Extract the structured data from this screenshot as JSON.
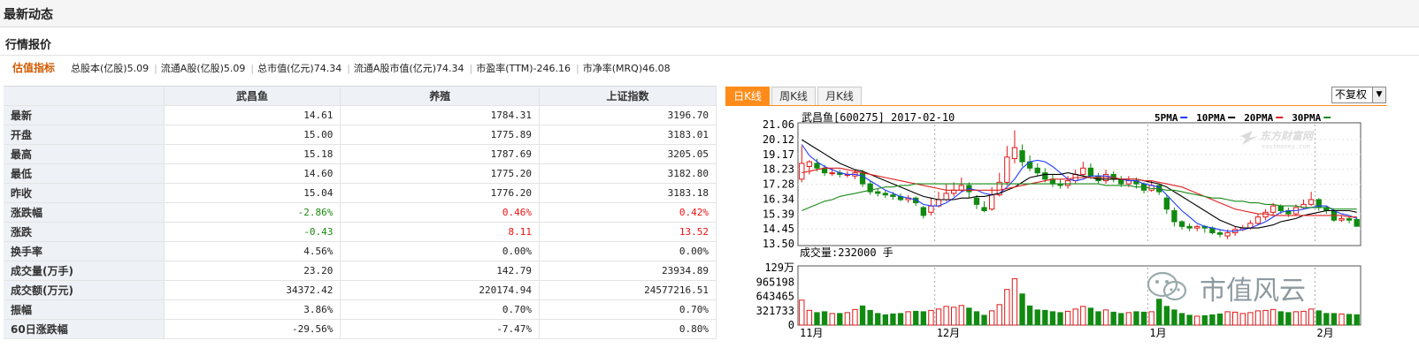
{
  "header": {
    "title": "最新动态"
  },
  "section": {
    "title": "行情报价"
  },
  "valuation": {
    "label": "估值指标",
    "items": [
      "总股本(亿股)5.09",
      "流通A股(亿股)5.09",
      "总市值(亿元)74.34",
      "流通A股市值(亿元)74.34",
      "市盈率(TTM)-246.16",
      "市净率(MRQ)46.08"
    ]
  },
  "quote_table": {
    "columns": [
      "",
      "武昌鱼",
      "养殖",
      "上证指数"
    ],
    "rows": [
      {
        "label": "最新",
        "v": [
          "14.61",
          "1784.31",
          "3196.70"
        ],
        "c": [
          "k",
          "k",
          "k"
        ]
      },
      {
        "label": "开盘",
        "v": [
          "15.00",
          "1775.89",
          "3183.01"
        ],
        "c": [
          "k",
          "k",
          "k"
        ]
      },
      {
        "label": "最高",
        "v": [
          "15.18",
          "1787.69",
          "3205.05"
        ],
        "c": [
          "k",
          "k",
          "k"
        ]
      },
      {
        "label": "最低",
        "v": [
          "14.60",
          "1775.20",
          "3182.80"
        ],
        "c": [
          "k",
          "k",
          "k"
        ]
      },
      {
        "label": "昨收",
        "v": [
          "15.04",
          "1776.20",
          "3183.18"
        ],
        "c": [
          "k",
          "k",
          "k"
        ]
      },
      {
        "label": "涨跌幅",
        "v": [
          "-2.86%",
          "0.46%",
          "0.42%"
        ],
        "c": [
          "g",
          "r",
          "r"
        ]
      },
      {
        "label": "涨跌",
        "v": [
          "-0.43",
          "8.11",
          "13.52"
        ],
        "c": [
          "g",
          "r",
          "r"
        ]
      },
      {
        "label": "换手率",
        "v": [
          "4.56%",
          "0.00%",
          "0.00%"
        ],
        "c": [
          "k",
          "k",
          "k"
        ]
      },
      {
        "label": "成交量(万手)",
        "v": [
          "23.20",
          "142.79",
          "23934.89"
        ],
        "c": [
          "k",
          "k",
          "k"
        ]
      },
      {
        "label": "成交额(万元)",
        "v": [
          "34372.42",
          "220174.94",
          "24577216.51"
        ],
        "c": [
          "k",
          "k",
          "k"
        ]
      },
      {
        "label": "振幅",
        "v": [
          "3.86%",
          "0.70%",
          "0.70%"
        ],
        "c": [
          "k",
          "k",
          "k"
        ]
      },
      {
        "label": "60日涨跌幅",
        "v": [
          "-29.56%",
          "-7.47%",
          "0.80%"
        ],
        "c": [
          "k",
          "k",
          "k"
        ]
      }
    ]
  },
  "chart_tabs": [
    "日K线",
    "周K线",
    "月K线"
  ],
  "fuquan": {
    "selected": "不复权",
    "arrow": "▼"
  },
  "kline": {
    "title": "武昌鱼[600275] 2017-02-10",
    "legend": [
      {
        "name": "5PMA",
        "color": "#1f3cff"
      },
      {
        "name": "10PMA",
        "color": "#000000"
      },
      {
        "name": "20PMA",
        "color": "#e02020"
      },
      {
        "name": "30PMA",
        "color": "#1a8a1a"
      }
    ],
    "watermark": "东方财富网",
    "watermark_sub": "eastmoney.com",
    "volume_label": "成交量:232000 手",
    "vol_unit": "129万",
    "x_labels": [
      "11月",
      "12月",
      "1月",
      "2月"
    ]
  },
  "chart_data": {
    "type": "candlestick",
    "ylim": [
      13.5,
      21.06
    ],
    "price_ticks": [
      "21.06",
      "20.12",
      "19.17",
      "18.23",
      "17.28",
      "16.34",
      "15.39",
      "14.45",
      "13.50"
    ],
    "vol_ticks": [
      "129万",
      "965198",
      "643465",
      "321733",
      "0"
    ],
    "vol_max": 1290000,
    "month_marks": [
      {
        "label": "11月",
        "i": 0
      },
      {
        "label": "12月",
        "i": 18
      },
      {
        "label": "1月",
        "i": 46
      },
      {
        "label": "2月",
        "i": 68
      }
    ],
    "candles": [
      [
        17.6,
        18.6,
        19.7,
        17.4,
        560000
      ],
      [
        18.4,
        18.7,
        18.8,
        17.9,
        330000
      ],
      [
        18.6,
        18.3,
        18.9,
        18.1,
        280000
      ],
      [
        18.3,
        18.0,
        18.5,
        17.8,
        300000
      ],
      [
        18.0,
        18.0,
        18.3,
        17.8,
        260000
      ],
      [
        18.0,
        17.9,
        18.2,
        17.7,
        260000
      ],
      [
        17.9,
        17.9,
        18.1,
        17.7,
        280000
      ],
      [
        17.8,
        18.0,
        18.2,
        17.6,
        350000
      ],
      [
        18.0,
        17.3,
        18.2,
        17.1,
        430000
      ],
      [
        17.3,
        16.8,
        17.5,
        16.6,
        330000
      ],
      [
        16.8,
        16.7,
        17.0,
        16.5,
        260000
      ],
      [
        16.7,
        16.6,
        16.9,
        16.4,
        230000
      ],
      [
        16.6,
        16.5,
        16.8,
        16.3,
        250000
      ],
      [
        16.5,
        16.3,
        16.7,
        16.2,
        260000
      ],
      [
        16.3,
        16.4,
        16.6,
        16.1,
        300000
      ],
      [
        16.4,
        16.1,
        16.5,
        15.9,
        310000
      ],
      [
        15.8,
        15.3,
        15.9,
        15.1,
        300000
      ],
      [
        15.5,
        15.9,
        16.4,
        15.3,
        330000
      ],
      [
        15.9,
        16.3,
        16.8,
        15.8,
        360000
      ],
      [
        16.3,
        16.7,
        17.3,
        16.2,
        420000
      ],
      [
        16.7,
        16.9,
        17.4,
        16.5,
        400000
      ],
      [
        16.9,
        17.2,
        17.7,
        16.8,
        440000
      ],
      [
        17.2,
        16.8,
        17.4,
        16.4,
        380000
      ],
      [
        16.4,
        16.0,
        16.6,
        15.7,
        300000
      ],
      [
        15.8,
        15.6,
        16.2,
        15.5,
        220000
      ],
      [
        15.7,
        16.6,
        17.1,
        15.6,
        320000
      ],
      [
        16.6,
        17.4,
        18.0,
        16.5,
        460000
      ],
      [
        17.4,
        19.0,
        19.7,
        17.2,
        800000
      ],
      [
        18.9,
        19.6,
        20.7,
        18.6,
        1040000
      ],
      [
        19.4,
        18.7,
        19.8,
        18.4,
        700000
      ],
      [
        18.7,
        18.3,
        19.1,
        18.1,
        430000
      ],
      [
        18.3,
        18.0,
        18.6,
        17.8,
        340000
      ],
      [
        18.0,
        17.6,
        18.3,
        17.4,
        330000
      ],
      [
        17.6,
        17.3,
        17.9,
        17.1,
        300000
      ],
      [
        17.3,
        17.2,
        17.6,
        17.0,
        280000
      ],
      [
        17.2,
        17.5,
        17.8,
        17.0,
        310000
      ],
      [
        17.5,
        17.9,
        18.2,
        17.3,
        360000
      ],
      [
        17.9,
        18.3,
        18.7,
        17.7,
        420000
      ],
      [
        18.3,
        17.8,
        18.6,
        17.6,
        380000
      ],
      [
        17.8,
        17.5,
        18.0,
        17.3,
        300000
      ],
      [
        17.5,
        17.9,
        18.2,
        17.3,
        340000
      ],
      [
        17.9,
        17.6,
        18.1,
        17.4,
        290000
      ],
      [
        17.6,
        17.3,
        17.8,
        17.1,
        260000
      ],
      [
        17.3,
        17.5,
        17.8,
        17.1,
        280000
      ],
      [
        17.5,
        17.3,
        17.7,
        17.0,
        300000
      ],
      [
        17.3,
        16.9,
        17.4,
        16.7,
        290000
      ],
      [
        16.9,
        17.2,
        17.5,
        16.8,
        300000
      ],
      [
        17.2,
        16.8,
        17.3,
        16.6,
        580000
      ],
      [
        16.4,
        15.7,
        16.6,
        15.4,
        420000
      ],
      [
        15.6,
        14.9,
        15.8,
        14.6,
        340000
      ],
      [
        14.9,
        14.6,
        15.0,
        14.4,
        260000
      ],
      [
        14.6,
        14.5,
        14.8,
        14.3,
        220000
      ],
      [
        14.5,
        14.6,
        14.7,
        14.3,
        200000
      ],
      [
        14.6,
        14.5,
        14.7,
        14.2,
        210000
      ],
      [
        14.5,
        14.2,
        14.6,
        14.1,
        230000
      ],
      [
        14.2,
        14.1,
        14.4,
        13.9,
        250000
      ],
      [
        14.0,
        14.2,
        14.4,
        13.8,
        300000
      ],
      [
        14.2,
        14.4,
        14.6,
        14.0,
        290000
      ],
      [
        14.4,
        14.5,
        14.7,
        14.3,
        260000
      ],
      [
        14.5,
        14.8,
        15.0,
        14.4,
        280000
      ],
      [
        14.8,
        15.2,
        15.4,
        14.7,
        320000
      ],
      [
        15.2,
        15.5,
        15.7,
        15.0,
        330000
      ],
      [
        15.5,
        15.9,
        16.1,
        15.3,
        350000
      ],
      [
        15.9,
        15.6,
        16.0,
        15.4,
        300000
      ],
      [
        15.6,
        15.4,
        15.8,
        15.2,
        280000
      ],
      [
        15.4,
        15.8,
        16.0,
        15.3,
        300000
      ],
      [
        15.8,
        16.0,
        16.3,
        15.7,
        310000
      ],
      [
        16.0,
        16.3,
        16.8,
        15.9,
        360000
      ],
      [
        16.3,
        15.8,
        16.4,
        15.6,
        320000
      ],
      [
        15.8,
        15.6,
        15.9,
        15.4,
        260000
      ],
      [
        15.6,
        15.0,
        15.7,
        14.9,
        260000
      ],
      [
        15.0,
        15.1,
        15.3,
        14.9,
        250000
      ],
      [
        15.1,
        15.0,
        15.2,
        14.8,
        240000
      ],
      [
        15.04,
        14.61,
        15.18,
        14.6,
        232000
      ]
    ],
    "ma": {
      "5PMA": [
        19.8,
        19.1,
        18.7,
        18.4,
        18.2,
        18.0,
        17.9,
        17.9,
        17.8,
        17.5,
        17.2,
        16.9,
        16.7,
        16.5,
        16.4,
        16.3,
        16.0,
        15.9,
        15.9,
        16.1,
        16.4,
        16.8,
        17.0,
        16.9,
        16.7,
        16.6,
        16.7,
        17.1,
        17.6,
        18.3,
        18.7,
        18.8,
        18.7,
        18.4,
        18.0,
        17.6,
        17.5,
        17.6,
        17.8,
        17.8,
        17.8,
        17.7,
        17.6,
        17.5,
        17.5,
        17.3,
        17.2,
        17.1,
        16.6,
        16.1,
        15.6,
        15.2,
        14.8,
        14.6,
        14.5,
        14.4,
        14.3,
        14.3,
        14.4,
        14.5,
        14.7,
        14.9,
        15.2,
        15.5,
        15.6,
        15.6,
        15.7,
        15.8,
        15.9,
        15.9,
        15.6,
        15.4,
        15.3,
        15.1
      ],
      "10PMA": [
        20.1,
        19.8,
        19.5,
        19.2,
        18.9,
        18.6,
        18.4,
        18.2,
        18.1,
        17.9,
        17.7,
        17.5,
        17.3,
        17.1,
        16.9,
        16.7,
        16.5,
        16.4,
        16.3,
        16.3,
        16.3,
        16.4,
        16.4,
        16.5,
        16.5,
        16.6,
        16.7,
        16.9,
        17.1,
        17.4,
        17.7,
        17.8,
        17.9,
        17.9,
        17.9,
        18.0,
        17.9,
        17.8,
        17.7,
        17.6,
        17.6,
        17.6,
        17.6,
        17.6,
        17.6,
        17.5,
        17.4,
        17.3,
        17.1,
        16.8,
        16.5,
        16.2,
        15.9,
        15.6,
        15.3,
        15.0,
        14.8,
        14.6,
        14.5,
        14.5,
        14.5,
        14.6,
        14.7,
        14.9,
        15.0,
        15.1,
        15.3,
        15.4,
        15.5,
        15.6,
        15.6,
        15.6,
        15.6,
        15.5
      ],
      "20PMA": [
        18.0,
        18.1,
        18.2,
        18.3,
        18.3,
        18.3,
        18.2,
        18.1,
        18.0,
        17.9,
        17.8,
        17.7,
        17.6,
        17.5,
        17.4,
        17.3,
        17.2,
        17.1,
        17.0,
        16.9,
        16.9,
        16.9,
        16.9,
        16.9,
        16.9,
        16.9,
        16.9,
        17.0,
        17.1,
        17.2,
        17.3,
        17.4,
        17.5,
        17.6,
        17.6,
        17.6,
        17.7,
        17.7,
        17.7,
        17.7,
        17.7,
        17.7,
        17.6,
        17.6,
        17.6,
        17.5,
        17.5,
        17.4,
        17.3,
        17.2,
        17.1,
        16.9,
        16.7,
        16.5,
        16.3,
        16.1,
        15.9,
        15.7,
        15.6,
        15.5,
        15.4,
        15.4,
        15.3,
        15.3,
        15.3,
        15.3,
        15.3,
        15.3,
        15.3,
        15.3,
        15.3,
        15.3,
        15.2,
        15.2
      ],
      "30PMA": [
        15.6,
        15.8,
        16.0,
        16.2,
        16.3,
        16.5,
        16.6,
        16.7,
        16.8,
        16.9,
        17.0,
        17.1,
        17.1,
        17.2,
        17.2,
        17.3,
        17.3,
        17.3,
        17.3,
        17.3,
        17.3,
        17.3,
        17.3,
        17.3,
        17.3,
        17.3,
        17.3,
        17.3,
        17.3,
        17.3,
        17.3,
        17.3,
        17.3,
        17.3,
        17.3,
        17.3,
        17.3,
        17.3,
        17.3,
        17.3,
        17.2,
        17.2,
        17.2,
        17.2,
        17.1,
        17.1,
        17.0,
        17.0,
        16.9,
        16.9,
        16.8,
        16.7,
        16.6,
        16.5,
        16.4,
        16.4,
        16.3,
        16.2,
        16.2,
        16.1,
        16.1,
        16.0,
        16.0,
        15.9,
        15.9,
        15.9,
        15.8,
        15.8,
        15.8,
        15.8,
        15.7,
        15.7,
        15.7,
        15.7
      ]
    }
  },
  "wechat": {
    "brand": "市值风云"
  }
}
